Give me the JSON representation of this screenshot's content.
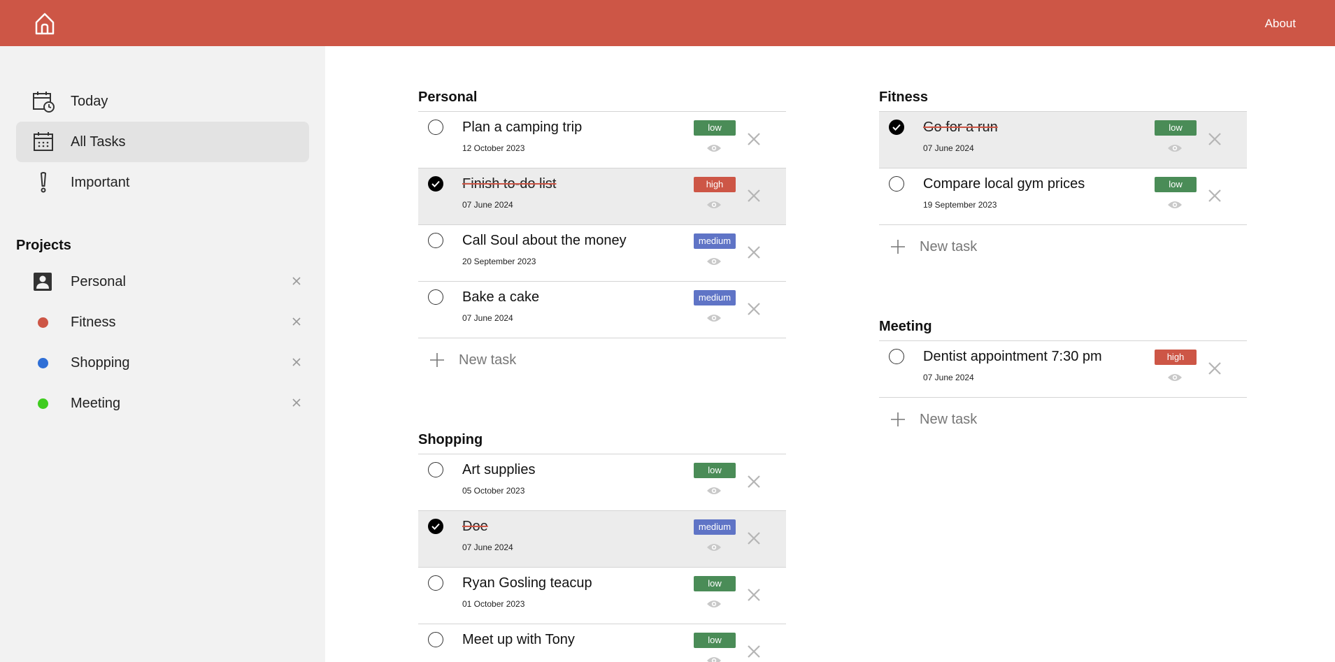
{
  "header": {
    "about_label": "About"
  },
  "sidebar": {
    "nav": [
      {
        "label": "Today"
      },
      {
        "label": "All Tasks"
      },
      {
        "label": "Important"
      }
    ],
    "projects_heading": "Projects",
    "projects": [
      {
        "label": "Personal",
        "icon": "person-icon"
      },
      {
        "label": "Fitness",
        "color": "#cd5646"
      },
      {
        "label": "Shopping",
        "color": "#2f6fd6"
      },
      {
        "label": "Meeting",
        "color": "#3fcc1f"
      }
    ]
  },
  "sections": {
    "personal": {
      "title": "Personal",
      "tasks": [
        {
          "title": "Plan a camping trip",
          "date": "12 October 2023",
          "priority": "low",
          "done": false
        },
        {
          "title": "Finish to-do list",
          "date": "07 June 2024",
          "priority": "high",
          "done": true
        },
        {
          "title": "Call Soul about the money",
          "date": "20 September 2023",
          "priority": "medium",
          "done": false
        },
        {
          "title": "Bake a cake",
          "date": "07 June 2024",
          "priority": "medium",
          "done": false
        }
      ],
      "new_task_label": "New task"
    },
    "shopping": {
      "title": "Shopping",
      "tasks": [
        {
          "title": "Art supplies",
          "date": "05 October 2023",
          "priority": "low",
          "done": false
        },
        {
          "title": "Doe",
          "date": "07 June 2024",
          "priority": "medium",
          "done": true
        },
        {
          "title": "Ryan Gosling teacup",
          "date": "01 October 2023",
          "priority": "low",
          "done": false
        },
        {
          "title": "Meet up with Tony",
          "date": "",
          "priority": "low",
          "done": false
        }
      ]
    },
    "fitness": {
      "title": "Fitness",
      "tasks": [
        {
          "title": "Go for a run",
          "date": "07 June 2024",
          "priority": "low",
          "done": true
        },
        {
          "title": "Compare local gym prices",
          "date": "19 September 2023",
          "priority": "low",
          "done": false
        }
      ],
      "new_task_label": "New task"
    },
    "meeting": {
      "title": "Meeting",
      "tasks": [
        {
          "title": "Dentist appointment 7:30 pm",
          "date": "07 June 2024",
          "priority": "high",
          "done": false
        }
      ],
      "new_task_label": "New task"
    }
  }
}
